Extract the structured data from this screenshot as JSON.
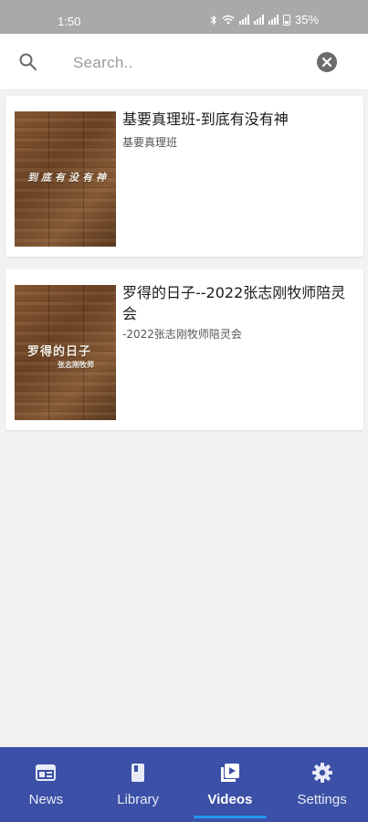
{
  "status_bar": {
    "time": "1:50",
    "battery": "35%"
  },
  "search": {
    "placeholder": "Search..",
    "value": ""
  },
  "videos": [
    {
      "title": "基要真理班-到底有没有神",
      "subtitle": "基要真理班",
      "thumbnail_text": "到底有没有神"
    },
    {
      "title": "罗得的日子--2022张志刚牧师陪灵会",
      "subtitle": "-2022张志刚牧师陪灵会",
      "thumbnail_text": "罗得的日子",
      "thumbnail_subtext": "张志刚牧师"
    }
  ],
  "bottom_nav": {
    "items": [
      {
        "label": "News",
        "icon": "news-icon"
      },
      {
        "label": "Library",
        "icon": "book-icon"
      },
      {
        "label": "Videos",
        "icon": "video-library-icon",
        "active": true
      },
      {
        "label": "Settings",
        "icon": "gear-icon"
      }
    ]
  },
  "colors": {
    "nav_background": "#3b50a6",
    "nav_indicator": "#2196f3",
    "status_bar": "#a9a9a9",
    "page_background": "#f2f2f2"
  }
}
